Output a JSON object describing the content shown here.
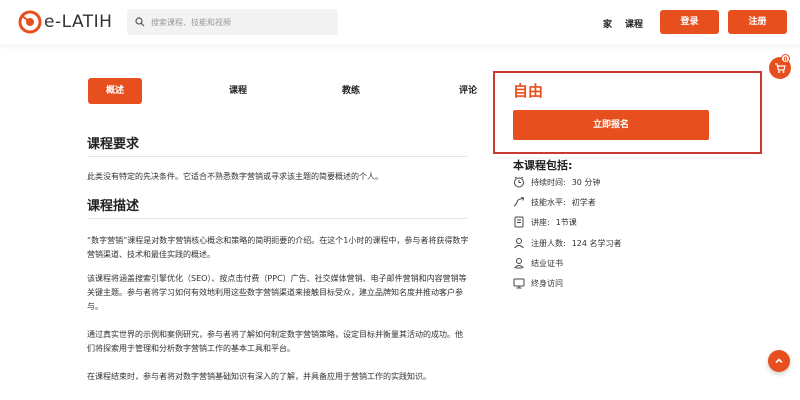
{
  "brand": {
    "logo_text": "e-LATIH"
  },
  "search": {
    "placeholder": "搜索课程、技能和视频"
  },
  "nav": {
    "home": "家",
    "courses": "课程",
    "login": "登录",
    "signup": "注册"
  },
  "cart": {
    "count": "0"
  },
  "tabs": [
    "概述",
    "课程",
    "教练",
    "评论"
  ],
  "content": {
    "requirements_title": "课程要求",
    "requirements_text": "此类没有特定的先决条件。它适合不熟悉数字营销或寻求该主题的简要概述的个人。",
    "description_title": "课程描述",
    "description_paragraphs": [
      "“数字营销”课程是对数字营销核心概念和策略的简明扼要的介绍。在这个1小时的课程中，参与者将获得数字营销渠道、技术和最佳实践的概述。",
      "该课程将涵盖搜索引擎优化（SEO）、按点击付费（PPC）广告、社交媒体营销、电子邮件营销和内容营销等关键主题。参与者将学习如何有效地利用这些数字营销渠道来接触目标受众，建立品牌知名度并推动客户参与。",
      "通过真实世界的示例和案例研究，参与者将了解如何制定数字营销策略，设定目标并衡量其活动的成功。他们将探索用于管理和分析数字营销工作的基本工具和平台。",
      "在课程结束时，参与者将对数字营销基础知识有深入的了解，并具备应用于营销工作的实践知识。"
    ]
  },
  "sidebar": {
    "price": "自由",
    "enroll": "立即报名",
    "includes_title": "本课程包括:",
    "items": [
      {
        "icon": "clock-icon",
        "label": "持续时间:",
        "value": "30 分钟"
      },
      {
        "icon": "level-icon",
        "label": "技能水平:",
        "value": "初学者"
      },
      {
        "icon": "lecture-icon",
        "label": "讲座:",
        "value": "1节课"
      },
      {
        "icon": "user-icon",
        "label": "注册人数:",
        "value": "124 名学习者"
      },
      {
        "icon": "certificate-icon",
        "label": "结业证书",
        "value": ""
      },
      {
        "icon": "monitor-icon",
        "label": "终身访问",
        "value": ""
      }
    ]
  },
  "colors": {
    "accent": "#e74f1f",
    "highlight_border": "#c93a30"
  }
}
